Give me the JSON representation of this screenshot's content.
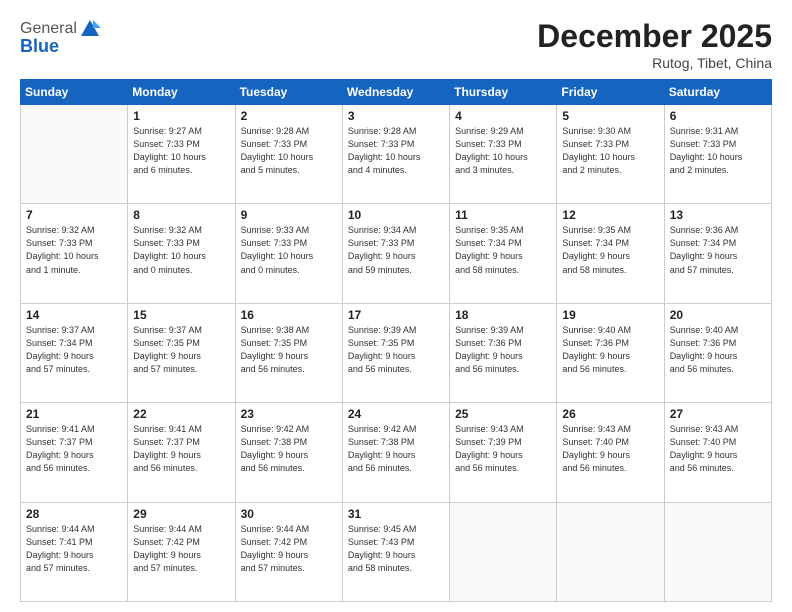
{
  "header": {
    "logo_general": "General",
    "logo_blue": "Blue",
    "month_title": "December 2025",
    "subtitle": "Rutog, Tibet, China"
  },
  "days_of_week": [
    "Sunday",
    "Monday",
    "Tuesday",
    "Wednesday",
    "Thursday",
    "Friday",
    "Saturday"
  ],
  "weeks": [
    [
      {
        "day": "",
        "info": ""
      },
      {
        "day": "1",
        "info": "Sunrise: 9:27 AM\nSunset: 7:33 PM\nDaylight: 10 hours\nand 6 minutes."
      },
      {
        "day": "2",
        "info": "Sunrise: 9:28 AM\nSunset: 7:33 PM\nDaylight: 10 hours\nand 5 minutes."
      },
      {
        "day": "3",
        "info": "Sunrise: 9:28 AM\nSunset: 7:33 PM\nDaylight: 10 hours\nand 4 minutes."
      },
      {
        "day": "4",
        "info": "Sunrise: 9:29 AM\nSunset: 7:33 PM\nDaylight: 10 hours\nand 3 minutes."
      },
      {
        "day": "5",
        "info": "Sunrise: 9:30 AM\nSunset: 7:33 PM\nDaylight: 10 hours\nand 2 minutes."
      },
      {
        "day": "6",
        "info": "Sunrise: 9:31 AM\nSunset: 7:33 PM\nDaylight: 10 hours\nand 2 minutes."
      }
    ],
    [
      {
        "day": "7",
        "info": "Sunrise: 9:32 AM\nSunset: 7:33 PM\nDaylight: 10 hours\nand 1 minute."
      },
      {
        "day": "8",
        "info": "Sunrise: 9:32 AM\nSunset: 7:33 PM\nDaylight: 10 hours\nand 0 minutes."
      },
      {
        "day": "9",
        "info": "Sunrise: 9:33 AM\nSunset: 7:33 PM\nDaylight: 10 hours\nand 0 minutes."
      },
      {
        "day": "10",
        "info": "Sunrise: 9:34 AM\nSunset: 7:33 PM\nDaylight: 9 hours\nand 59 minutes."
      },
      {
        "day": "11",
        "info": "Sunrise: 9:35 AM\nSunset: 7:34 PM\nDaylight: 9 hours\nand 58 minutes."
      },
      {
        "day": "12",
        "info": "Sunrise: 9:35 AM\nSunset: 7:34 PM\nDaylight: 9 hours\nand 58 minutes."
      },
      {
        "day": "13",
        "info": "Sunrise: 9:36 AM\nSunset: 7:34 PM\nDaylight: 9 hours\nand 57 minutes."
      }
    ],
    [
      {
        "day": "14",
        "info": "Sunrise: 9:37 AM\nSunset: 7:34 PM\nDaylight: 9 hours\nand 57 minutes."
      },
      {
        "day": "15",
        "info": "Sunrise: 9:37 AM\nSunset: 7:35 PM\nDaylight: 9 hours\nand 57 minutes."
      },
      {
        "day": "16",
        "info": "Sunrise: 9:38 AM\nSunset: 7:35 PM\nDaylight: 9 hours\nand 56 minutes."
      },
      {
        "day": "17",
        "info": "Sunrise: 9:39 AM\nSunset: 7:35 PM\nDaylight: 9 hours\nand 56 minutes."
      },
      {
        "day": "18",
        "info": "Sunrise: 9:39 AM\nSunset: 7:36 PM\nDaylight: 9 hours\nand 56 minutes."
      },
      {
        "day": "19",
        "info": "Sunrise: 9:40 AM\nSunset: 7:36 PM\nDaylight: 9 hours\nand 56 minutes."
      },
      {
        "day": "20",
        "info": "Sunrise: 9:40 AM\nSunset: 7:36 PM\nDaylight: 9 hours\nand 56 minutes."
      }
    ],
    [
      {
        "day": "21",
        "info": "Sunrise: 9:41 AM\nSunset: 7:37 PM\nDaylight: 9 hours\nand 56 minutes."
      },
      {
        "day": "22",
        "info": "Sunrise: 9:41 AM\nSunset: 7:37 PM\nDaylight: 9 hours\nand 56 minutes."
      },
      {
        "day": "23",
        "info": "Sunrise: 9:42 AM\nSunset: 7:38 PM\nDaylight: 9 hours\nand 56 minutes."
      },
      {
        "day": "24",
        "info": "Sunrise: 9:42 AM\nSunset: 7:38 PM\nDaylight: 9 hours\nand 56 minutes."
      },
      {
        "day": "25",
        "info": "Sunrise: 9:43 AM\nSunset: 7:39 PM\nDaylight: 9 hours\nand 56 minutes."
      },
      {
        "day": "26",
        "info": "Sunrise: 9:43 AM\nSunset: 7:40 PM\nDaylight: 9 hours\nand 56 minutes."
      },
      {
        "day": "27",
        "info": "Sunrise: 9:43 AM\nSunset: 7:40 PM\nDaylight: 9 hours\nand 56 minutes."
      }
    ],
    [
      {
        "day": "28",
        "info": "Sunrise: 9:44 AM\nSunset: 7:41 PM\nDaylight: 9 hours\nand 57 minutes."
      },
      {
        "day": "29",
        "info": "Sunrise: 9:44 AM\nSunset: 7:42 PM\nDaylight: 9 hours\nand 57 minutes."
      },
      {
        "day": "30",
        "info": "Sunrise: 9:44 AM\nSunset: 7:42 PM\nDaylight: 9 hours\nand 57 minutes."
      },
      {
        "day": "31",
        "info": "Sunrise: 9:45 AM\nSunset: 7:43 PM\nDaylight: 9 hours\nand 58 minutes."
      },
      {
        "day": "",
        "info": ""
      },
      {
        "day": "",
        "info": ""
      },
      {
        "day": "",
        "info": ""
      }
    ]
  ]
}
